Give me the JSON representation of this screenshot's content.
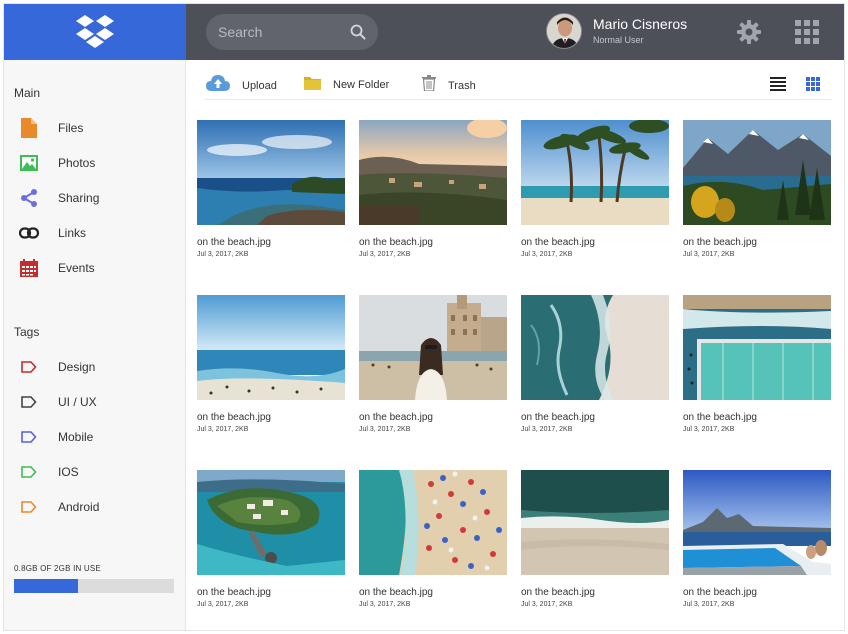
{
  "search": {
    "placeholder": "Search"
  },
  "user": {
    "name": "Mario Cisneros",
    "role": "Normal User"
  },
  "sidebar": {
    "main_title": "Main",
    "main_items": [
      {
        "label": "Files",
        "icon": "file-icon",
        "color": "#e8892b"
      },
      {
        "label": "Photos",
        "icon": "image-icon",
        "color": "#3ebd55"
      },
      {
        "label": "Sharing",
        "icon": "share-icon",
        "color": "#6a6ee0"
      },
      {
        "label": "Links",
        "icon": "link-icon",
        "color": "#222222"
      },
      {
        "label": "Events",
        "icon": "calendar-icon",
        "color": "#c72b2b"
      }
    ],
    "tags_title": "Tags",
    "tags": [
      {
        "label": "Design",
        "color": "#c72b2b"
      },
      {
        "label": "UI / UX",
        "color": "#444444"
      },
      {
        "label": "Mobile",
        "color": "#5b5ee0"
      },
      {
        "label": "IOS",
        "color": "#3ebd55"
      },
      {
        "label": "Android",
        "color": "#e8892b"
      }
    ],
    "storage": {
      "label": "0.8GB OF 2GB IN USE",
      "fraction": 0.4
    }
  },
  "toolbar": {
    "upload": "Upload",
    "new_folder": "New Folder",
    "trash": "Trash"
  },
  "files": [
    {
      "name": "on the beach.jpg",
      "meta": "Jul 3, 2017,  2KB",
      "scene": "sea-islands"
    },
    {
      "name": "on the beach.jpg",
      "meta": "Jul 3, 2017,  2KB",
      "scene": "coast-sunset"
    },
    {
      "name": "on the beach.jpg",
      "meta": "Jul 3, 2017,  2KB",
      "scene": "palms"
    },
    {
      "name": "on the beach.jpg",
      "meta": "Jul 3, 2017,  2KB",
      "scene": "mountains"
    },
    {
      "name": "on the beach.jpg",
      "meta": "Jul 3, 2017,  2KB",
      "scene": "shore"
    },
    {
      "name": "on the beach.jpg",
      "meta": "Jul 3, 2017,  2KB",
      "scene": "girl-beach"
    },
    {
      "name": "on the beach.jpg",
      "meta": "Jul 3, 2017,  2KB",
      "scene": "aerial-waves"
    },
    {
      "name": "on the beach.jpg",
      "meta": "Jul 3, 2017,  2KB",
      "scene": "pool"
    },
    {
      "name": "on the beach.jpg",
      "meta": "Jul 3, 2017,  2KB",
      "scene": "island-resort"
    },
    {
      "name": "on the beach.jpg",
      "meta": "Jul 3, 2017,  2KB",
      "scene": "umbrellas"
    },
    {
      "name": "on the beach.jpg",
      "meta": "Jul 3, 2017,  2KB",
      "scene": "sand-sea"
    },
    {
      "name": "on the beach.jpg",
      "meta": "Jul 3, 2017,  2KB",
      "scene": "infinity-pool"
    }
  ],
  "colors": {
    "brand": "#3768d9",
    "topbar": "#4d4f59",
    "upload": "#5b9bdb",
    "folder": "#d4b223"
  }
}
